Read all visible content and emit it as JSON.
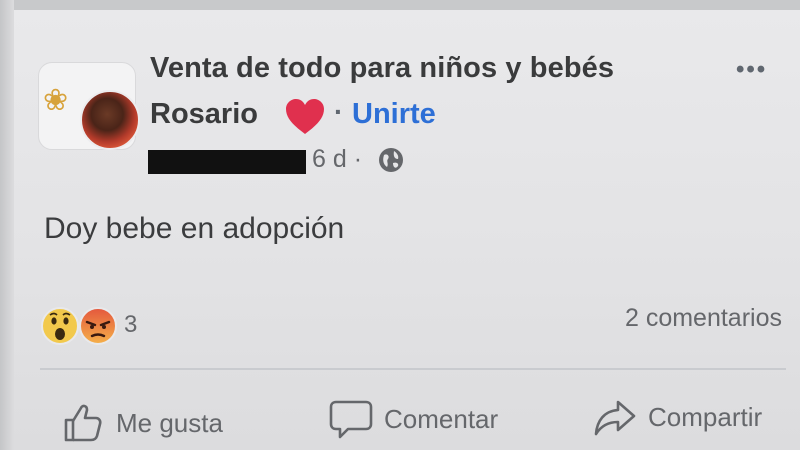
{
  "post": {
    "group_name": "Venta de todo para niños y bebés",
    "group_city": "Rosario",
    "join_label": "Unirte",
    "separator": "·",
    "more_label": "•••",
    "time": "6 d ·",
    "text": "Doy bebe en adopción"
  },
  "reactions": {
    "icons": [
      "wow-emoji",
      "angry-emoji"
    ],
    "count": "3",
    "comments_label": "2 comentarios"
  },
  "actions": {
    "like_label": "Me gusta",
    "comment_label": "Comentar",
    "share_label": "Compartir"
  },
  "colors": {
    "link_blue": "#2d6fd6",
    "heart_red": "#e0304e",
    "wow_yellow": "#f2c94c",
    "angry_red": "#e4573d"
  }
}
